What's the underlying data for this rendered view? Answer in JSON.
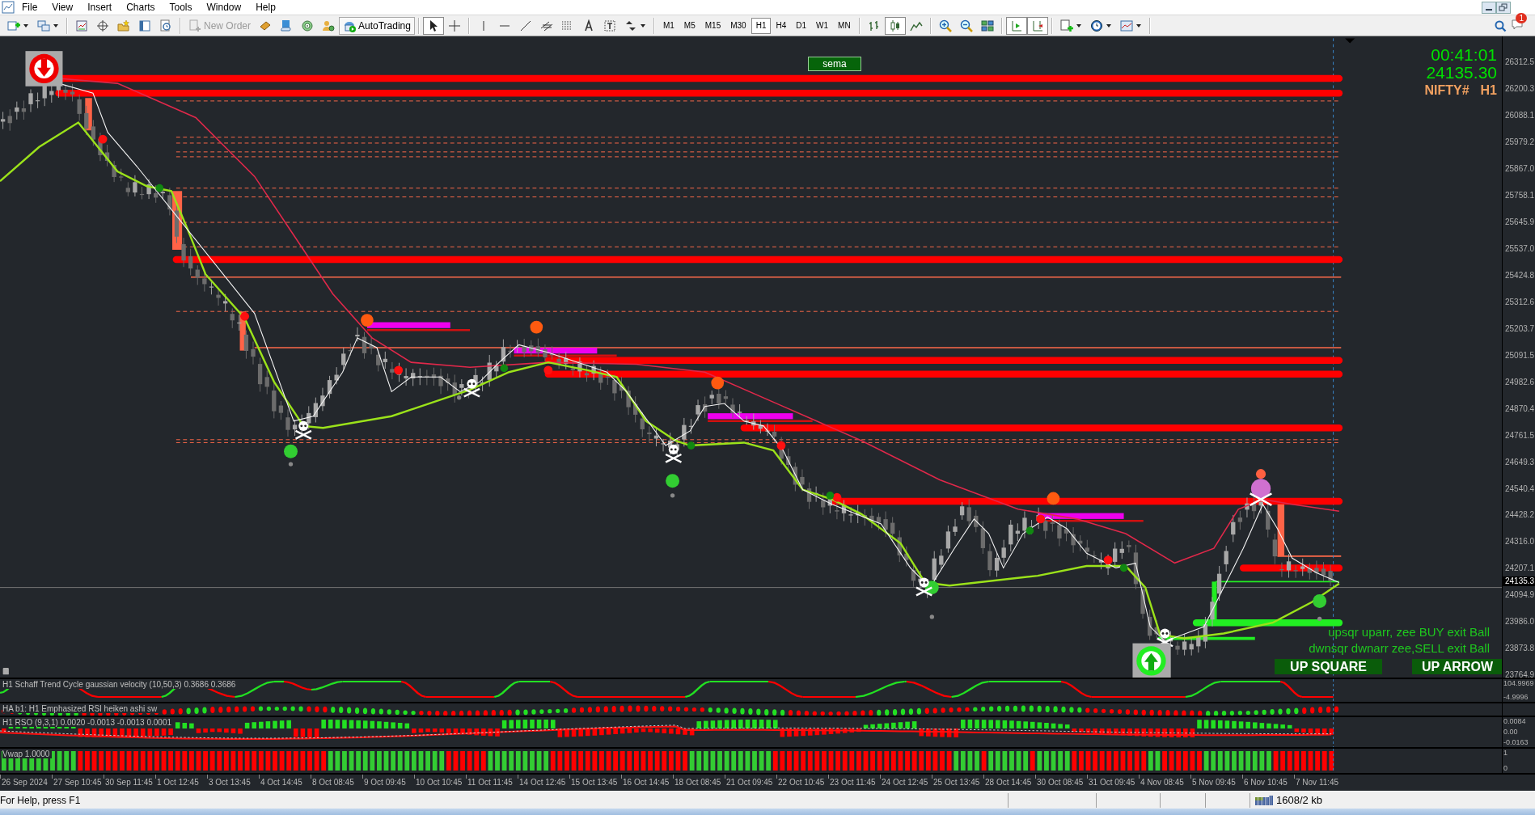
{
  "menu": [
    "File",
    "View",
    "Insert",
    "Charts",
    "Tools",
    "Window",
    "Help"
  ],
  "toolbar": {
    "new_order": {
      "label": "New Order",
      "disabled": true
    },
    "autotrading": {
      "label": "AutoTrading",
      "on": true
    },
    "drawing_tools": [
      {
        "kind": "cursor",
        "selected": true
      },
      {
        "kind": "crosshair",
        "selected": false
      }
    ],
    "timeframes": [
      {
        "label": "M1",
        "selected": false
      },
      {
        "label": "M5",
        "selected": false
      },
      {
        "label": "M15",
        "selected": false
      },
      {
        "label": "M30",
        "selected": false
      },
      {
        "label": "H1",
        "selected": true
      },
      {
        "label": "H4",
        "selected": false
      },
      {
        "label": "D1",
        "selected": false
      },
      {
        "label": "W1",
        "selected": false
      },
      {
        "label": "MN",
        "selected": false
      }
    ],
    "chart_types": [
      {
        "kind": "bars",
        "selected": false
      },
      {
        "kind": "candles",
        "selected": true
      },
      {
        "kind": "line",
        "selected": false
      }
    ],
    "auto_scroll": true,
    "chart_shift": true,
    "notification_count": "1"
  },
  "chart": {
    "indicator_button": "sema",
    "clock": "00:41:01",
    "price": "24135.30",
    "symbol": "NIFTY#",
    "period": "H1",
    "legend": [
      "upsqr uparr, zee BUY exit Ball",
      "dwnsqr dwnarr zee,SELL exit Ball"
    ],
    "signals": [
      "UP SQUARE",
      "UP ARROW"
    ],
    "price_axis": [
      "26312.5",
      "26200.3",
      "26088.1",
      "25979.2",
      "25867.0",
      "25758.1",
      "25645.9",
      "25537.0",
      "25424.8",
      "25312.6",
      "25203.7",
      "25091.5",
      "24982.6",
      "24870.4",
      "24761.5",
      "24649.3",
      "24540.4",
      "24428.2",
      "24316.0",
      "24207.1",
      "24094.9",
      "23986.0",
      "23873.8",
      "23764.9"
    ],
    "current_price_tag": "24135.3"
  },
  "subwindows": [
    {
      "kind": "stc",
      "label": "H1 Schaff Trend Cycle gaussian velocity (10,50,3) 0.3686 0.3686",
      "axis": [
        "104.9969",
        "-4.9996"
      ]
    },
    {
      "kind": "dots",
      "label": "HA b1: H1 Emphasized RSI heiken ashi sw"
    },
    {
      "kind": "histogram",
      "label": "H1 RSO (9,3,1) 0.0020 -0.0013 -0.0013 0.0001",
      "axis": [
        "0.0084",
        "0.00",
        "-0.0163"
      ]
    },
    {
      "kind": "bars",
      "label": "Vwap 1.0000",
      "axis": [
        "1",
        "0"
      ]
    }
  ],
  "time_axis": [
    "26 Sep 2024",
    "27 Sep 10:45",
    "30 Sep 11:45",
    "1 Oct 12:45",
    "3 Oct 13:45",
    "4 Oct 14:45",
    "8 Oct 08:45",
    "9 Oct 09:45",
    "10 Oct 10:45",
    "11 Oct 11:45",
    "14 Oct 12:45",
    "15 Oct 13:45",
    "16 Oct 14:45",
    "18 Oct 08:45",
    "21 Oct 09:45",
    "22 Oct 10:45",
    "23 Oct 11:45",
    "24 Oct 12:45",
    "25 Oct 13:45",
    "28 Oct 14:45",
    "30 Oct 08:45",
    "31 Oct 09:45",
    "4 Nov 08:45",
    "5 Nov 09:45",
    "6 Nov 10:45",
    "7 Nov 11:45"
  ],
  "status_bar": {
    "help": "For Help, press F1",
    "traffic": "1608/2 kb"
  }
}
